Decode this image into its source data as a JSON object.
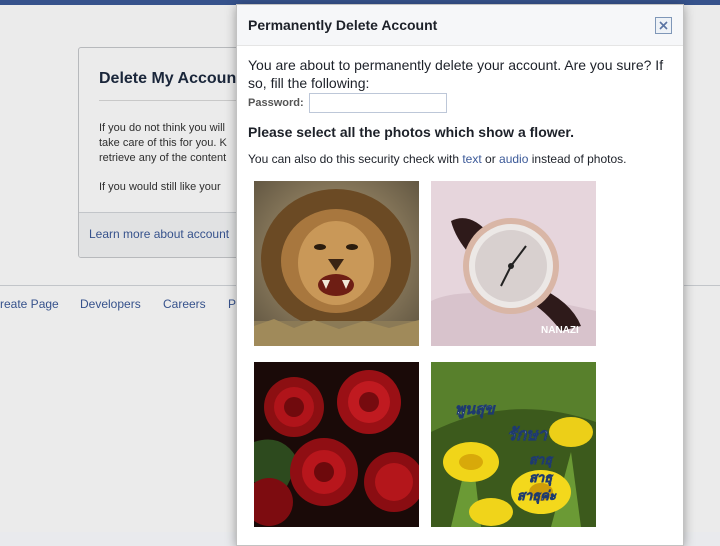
{
  "background": {
    "card_title": "Delete My Accoun",
    "para1_line1": "If you do not think you will",
    "para1_line2": "take care of this for you. K",
    "para1_line3": "retrieve any of the content",
    "para2": "If you would still like your",
    "learn_more": "Learn more about account",
    "footer_links": [
      "reate Page",
      "Developers",
      "Careers",
      "P"
    ]
  },
  "dialog": {
    "title": "Permanently Delete Account",
    "intro": "You are about to permanently delete your account. Are you sure? If so, fill the following:",
    "password_label": "Password:",
    "password_value": "",
    "prompt": "Please select all the photos which show a flower.",
    "alt_prefix": "You can also do this security check with ",
    "alt_text_link": "text",
    "alt_or": " or ",
    "alt_audio_link": "audio",
    "alt_suffix": " instead of photos.",
    "photos": [
      {
        "subject": "lion"
      },
      {
        "subject": "wristwatch",
        "watermark": "NANAZI"
      },
      {
        "subject": "red roses"
      },
      {
        "subject": "yellow flowers",
        "overlay_text": [
          "พูนสุข",
          "รักษา",
          "สาธุ",
          "สาธุ",
          "สาธุค่ะ"
        ]
      }
    ]
  },
  "colors": {
    "link": "#3b5998",
    "topbar": "#3b5998"
  }
}
